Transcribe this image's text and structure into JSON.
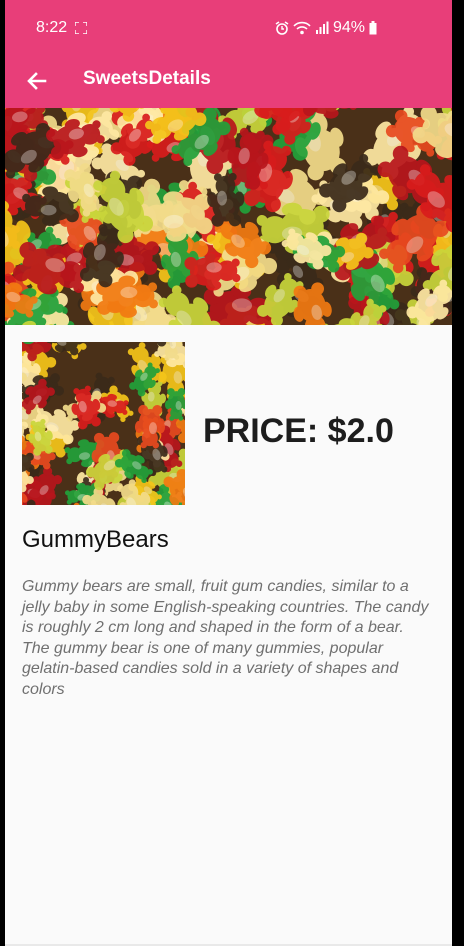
{
  "status_bar": {
    "time": "8:22",
    "battery": "94%",
    "icons": [
      "screenshot-icon",
      "alarm-icon",
      "wifi-icon",
      "signal-icon",
      "battery-icon"
    ]
  },
  "toolbar": {
    "title": "SweetsDetails",
    "back_icon": "arrow-left-icon"
  },
  "colors": {
    "primary": "#e83e79",
    "background": "#fafafa",
    "price_text": "#1d1d1d",
    "description_text": "#707070"
  },
  "product": {
    "price_label": "PRICE: $2.0",
    "name": "GummyBears",
    "description": "Gummy bears are small, fruit gum candies, similar to a jelly baby in some English-speaking countries. The candy is roughly 2 cm long and shaped in the form of a bear. The gummy bear is one of many gummies, popular gelatin-based candies sold in a variety of shapes and colors"
  }
}
